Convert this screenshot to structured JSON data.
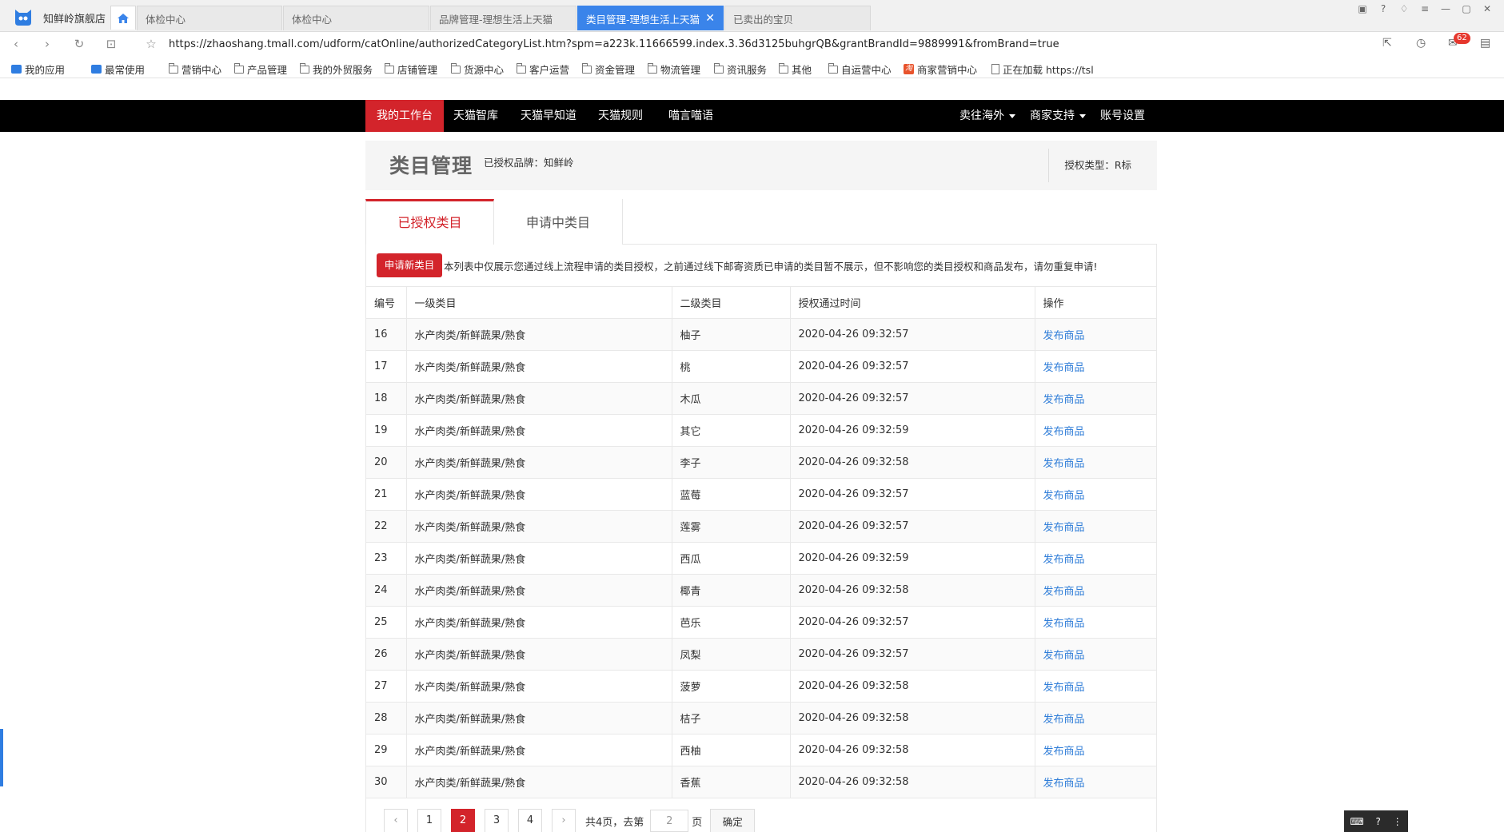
{
  "browser": {
    "brand_name": "知鲜岭旗舰店",
    "tabs": [
      {
        "label": "体检中心",
        "active": false
      },
      {
        "label": "体检中心",
        "active": false
      },
      {
        "label": "品牌管理-理想生活上天猫",
        "active": false
      },
      {
        "label": "类目管理-理想生活上天猫",
        "active": true
      },
      {
        "label": "已卖出的宝贝",
        "active": false
      }
    ],
    "url": "https://zhaoshang.tmall.com/udform/catOnline/authorizedCategoryList.htm?spm=a223k.11666599.index.3.36d3125buhgrQB&grantBrandId=9889991&fromBrand=true",
    "mail_count": "62",
    "bookmarks": [
      {
        "label": "我的应用",
        "icon": "app-icon"
      },
      {
        "label": "最常使用",
        "icon": "app-icon"
      },
      {
        "label": "营销中心",
        "icon": "folder-icon"
      },
      {
        "label": "产品管理",
        "icon": "folder-icon"
      },
      {
        "label": "我的外贸服务",
        "icon": "folder-icon"
      },
      {
        "label": "店铺管理",
        "icon": "folder-icon"
      },
      {
        "label": "货源中心",
        "icon": "folder-icon"
      },
      {
        "label": "客户运营",
        "icon": "folder-icon"
      },
      {
        "label": "资金管理",
        "icon": "folder-icon"
      },
      {
        "label": "物流管理",
        "icon": "folder-icon"
      },
      {
        "label": "资讯服务",
        "icon": "folder-icon"
      },
      {
        "label": "其他",
        "icon": "folder-icon"
      },
      {
        "label": "自运营中心",
        "icon": "folder-icon"
      },
      {
        "label": "商家营销中心",
        "icon": "marketing-icon"
      },
      {
        "label": "正在加载 https://tsl",
        "icon": "page-icon"
      }
    ]
  },
  "site_nav": {
    "left": [
      "我的工作台",
      "天猫智库",
      "天猫早知道",
      "天猫规则",
      "喵言喵语"
    ],
    "right": [
      "卖往海外",
      "商家支持",
      "账号设置"
    ]
  },
  "header": {
    "title": "类目管理",
    "brand_label": "已授权品牌：知鲜岭",
    "auth_type": "授权类型：R标"
  },
  "tabs": {
    "authorized": "已授权类目",
    "applying": "申请中类目"
  },
  "toolbar": {
    "apply_label": "申请新类目",
    "notice": "本列表中仅展示您通过线上流程申请的类目授权，之前通过线下邮寄资质已申请的类目暂不展示，但不影响您的类目授权和商品发布，请勿重复申请!"
  },
  "table": {
    "columns": [
      "编号",
      "一级类目",
      "二级类目",
      "授权通过时间",
      "操作"
    ],
    "rows": [
      {
        "id": "16",
        "cat1": "水产肉类/新鲜蔬果/熟食",
        "cat2": "柚子",
        "time": "2020-04-26 09:32:57",
        "action": "发布商品"
      },
      {
        "id": "17",
        "cat1": "水产肉类/新鲜蔬果/熟食",
        "cat2": "桃",
        "time": "2020-04-26 09:32:57",
        "action": "发布商品"
      },
      {
        "id": "18",
        "cat1": "水产肉类/新鲜蔬果/熟食",
        "cat2": "木瓜",
        "time": "2020-04-26 09:32:57",
        "action": "发布商品"
      },
      {
        "id": "19",
        "cat1": "水产肉类/新鲜蔬果/熟食",
        "cat2": "其它",
        "time": "2020-04-26 09:32:59",
        "action": "发布商品"
      },
      {
        "id": "20",
        "cat1": "水产肉类/新鲜蔬果/熟食",
        "cat2": "李子",
        "time": "2020-04-26 09:32:58",
        "action": "发布商品"
      },
      {
        "id": "21",
        "cat1": "水产肉类/新鲜蔬果/熟食",
        "cat2": "蓝莓",
        "time": "2020-04-26 09:32:57",
        "action": "发布商品"
      },
      {
        "id": "22",
        "cat1": "水产肉类/新鲜蔬果/熟食",
        "cat2": "莲雾",
        "time": "2020-04-26 09:32:57",
        "action": "发布商品"
      },
      {
        "id": "23",
        "cat1": "水产肉类/新鲜蔬果/熟食",
        "cat2": "西瓜",
        "time": "2020-04-26 09:32:59",
        "action": "发布商品"
      },
      {
        "id": "24",
        "cat1": "水产肉类/新鲜蔬果/熟食",
        "cat2": "椰青",
        "time": "2020-04-26 09:32:58",
        "action": "发布商品"
      },
      {
        "id": "25",
        "cat1": "水产肉类/新鲜蔬果/熟食",
        "cat2": "芭乐",
        "time": "2020-04-26 09:32:57",
        "action": "发布商品"
      },
      {
        "id": "26",
        "cat1": "水产肉类/新鲜蔬果/熟食",
        "cat2": "凤梨",
        "time": "2020-04-26 09:32:57",
        "action": "发布商品"
      },
      {
        "id": "27",
        "cat1": "水产肉类/新鲜蔬果/熟食",
        "cat2": "菠萝",
        "time": "2020-04-26 09:32:58",
        "action": "发布商品"
      },
      {
        "id": "28",
        "cat1": "水产肉类/新鲜蔬果/熟食",
        "cat2": "桔子",
        "time": "2020-04-26 09:32:58",
        "action": "发布商品"
      },
      {
        "id": "29",
        "cat1": "水产肉类/新鲜蔬果/熟食",
        "cat2": "西柚",
        "time": "2020-04-26 09:32:58",
        "action": "发布商品"
      },
      {
        "id": "30",
        "cat1": "水产肉类/新鲜蔬果/熟食",
        "cat2": "香蕉",
        "time": "2020-04-26 09:32:58",
        "action": "发布商品"
      }
    ]
  },
  "pagination": {
    "pages": [
      "1",
      "2",
      "3",
      "4"
    ],
    "current": "2",
    "total_label": "共4页，去第",
    "goto_value": "2",
    "page_suffix": "页",
    "confirm_label": "确定"
  },
  "colors": {
    "accent_red": "#d3242b",
    "link_blue": "#2f7dd8",
    "tab_blue": "#3a84ea"
  }
}
